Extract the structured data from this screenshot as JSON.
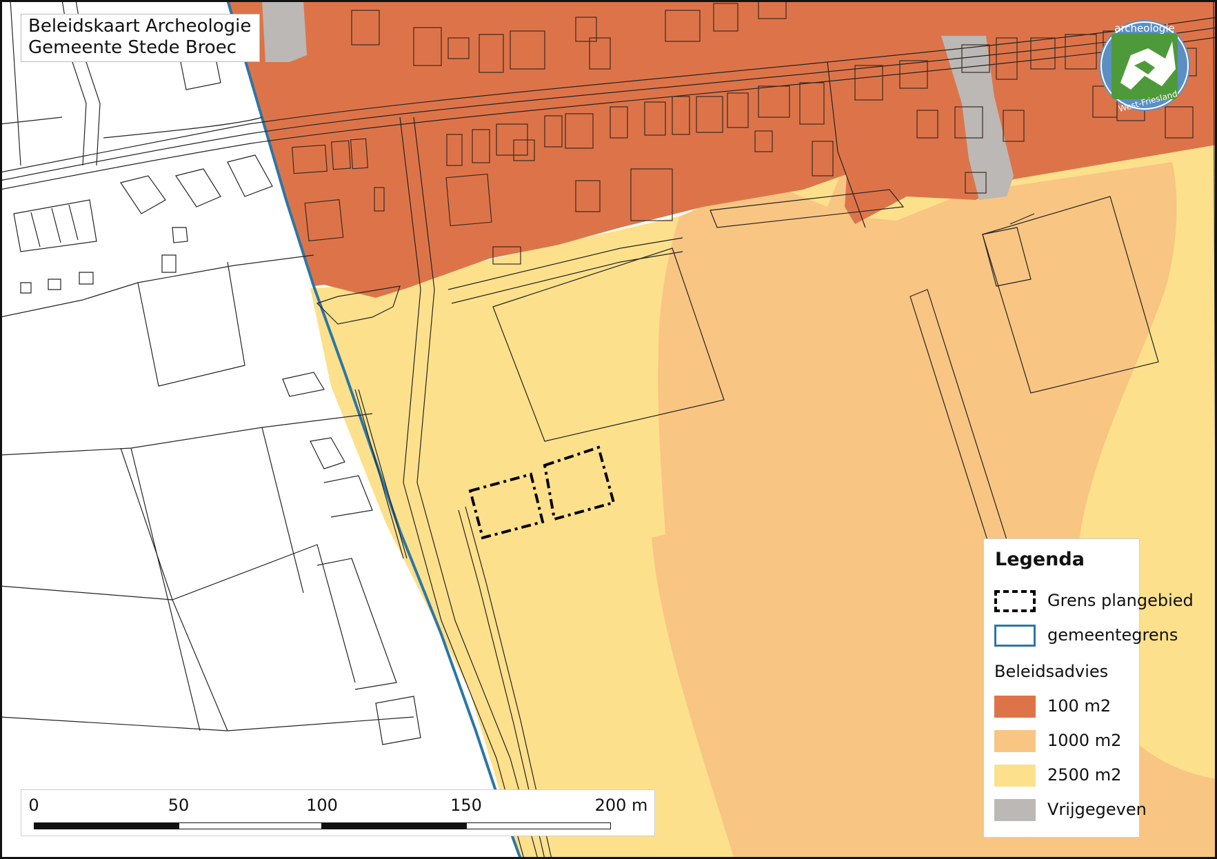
{
  "title": {
    "line1": "Beleidskaart Archeologie",
    "line2": "Gemeente Stede Broec"
  },
  "logo": {
    "top_text": "archeologie",
    "bottom_text": "West-Friesland"
  },
  "legend": {
    "title": "Legenda",
    "items": [
      {
        "label": "Grens plangebied",
        "style": "dashed-outline",
        "color": "#000000"
      },
      {
        "label": "gemeentegrens",
        "style": "outline",
        "color": "#2b76a6"
      }
    ],
    "subtitle": "Beleidsadvies",
    "classes": [
      {
        "label": "100 m2",
        "color": "#dd7449"
      },
      {
        "label": "1000 m2",
        "color": "#f8c583"
      },
      {
        "label": "2500 m2",
        "color": "#fde08c"
      },
      {
        "label": "Vrijgegeven",
        "color": "#bcb8b6"
      }
    ]
  },
  "scalebar": {
    "labels": [
      "0",
      "50",
      "100",
      "150",
      "200 m"
    ]
  }
}
